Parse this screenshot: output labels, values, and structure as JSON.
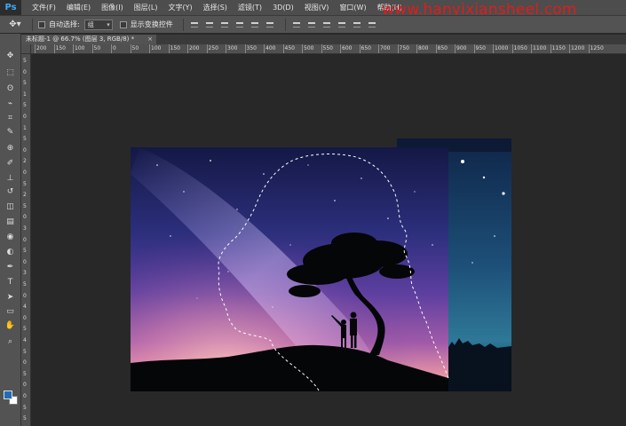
{
  "app": {
    "logo": "Ps"
  },
  "watermark": "www.hanyixiansheel.com",
  "menu": [
    {
      "label": "文件(F)"
    },
    {
      "label": "编辑(E)"
    },
    {
      "label": "图像(I)"
    },
    {
      "label": "图层(L)"
    },
    {
      "label": "文字(Y)"
    },
    {
      "label": "选择(S)"
    },
    {
      "label": "滤镜(T)"
    },
    {
      "label": "3D(D)"
    },
    {
      "label": "视图(V)"
    },
    {
      "label": "窗口(W)"
    },
    {
      "label": "帮助(H)"
    }
  ],
  "options": {
    "tool_icon": "move-tool-icon",
    "auto_select_label": "自动选择:",
    "auto_select_value": "组",
    "show_transform_label": "显示变换控件"
  },
  "document": {
    "tab_title": "未标题-1 @ 66.7% (图层 3, RGB/8) *",
    "close": "×"
  },
  "ruler": {
    "h_ticks": [
      "200",
      "150",
      "100",
      "50",
      "0",
      "50",
      "100",
      "150",
      "200",
      "250",
      "300",
      "350",
      "400",
      "450",
      "500",
      "550",
      "600",
      "650",
      "700",
      "750",
      "800",
      "850",
      "900",
      "950",
      "1000",
      "1050",
      "1100",
      "1150",
      "1200",
      "1250"
    ],
    "v_ticks": [
      "5",
      "0",
      "5",
      "1",
      "5",
      "0",
      "1",
      "5",
      "0",
      "2",
      "0",
      "5",
      "2",
      "5",
      "0",
      "3",
      "0",
      "5",
      "0",
      "3",
      "5",
      "0",
      "4",
      "0",
      "5",
      "4",
      "5",
      "0",
      "5",
      "0",
      "0",
      "5",
      "5"
    ]
  },
  "tools": [
    "move-tool-icon",
    "marquee-tool-icon",
    "lasso-tool-icon",
    "quick-select-tool-icon",
    "crop-tool-icon",
    "eyedropper-tool-icon",
    "healing-brush-tool-icon",
    "brush-tool-icon",
    "clone-stamp-tool-icon",
    "history-brush-tool-icon",
    "eraser-tool-icon",
    "gradient-tool-icon",
    "blur-tool-icon",
    "dodge-tool-icon",
    "pen-tool-icon",
    "type-tool-icon",
    "path-select-tool-icon",
    "shape-tool-icon",
    "hand-tool-icon",
    "zoom-tool-icon"
  ],
  "colors": {
    "foreground": "#1f6eb4",
    "background": "#ffffff",
    "accent": "#3fa9f5"
  }
}
